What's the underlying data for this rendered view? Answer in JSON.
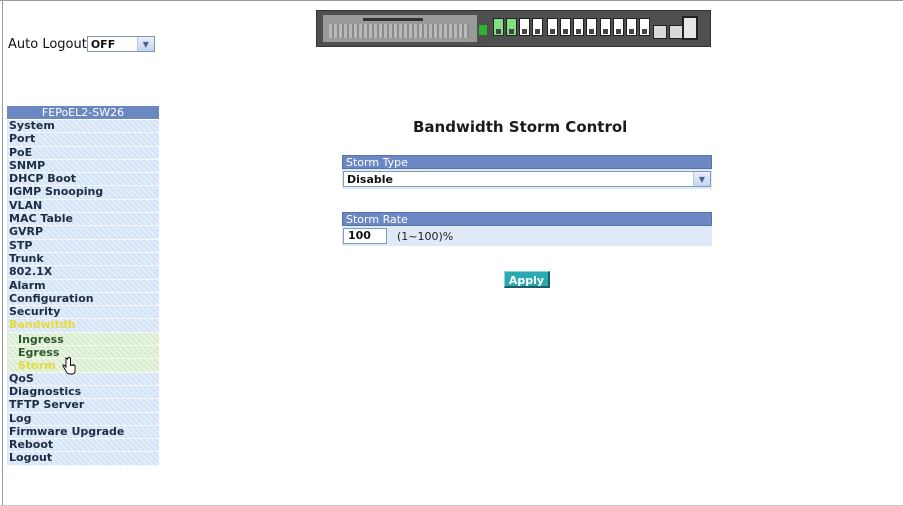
{
  "auto_logout": {
    "label": "Auto Logout",
    "value": "OFF"
  },
  "sidebar": {
    "title": "FEPoEL2-SW26",
    "items_before": [
      "System",
      "Port",
      "PoE",
      "SNMP",
      "DHCP Boot",
      "IGMP Snooping",
      "VLAN",
      "MAC Table",
      "GVRP",
      "STP",
      "Trunk",
      "802.1X",
      "Alarm",
      "Configuration",
      "Security"
    ],
    "open_item": "Bandwitdh",
    "subitems": [
      "Ingress",
      "Egress",
      "Storm"
    ],
    "active_subitem": "Storm",
    "items_after": [
      "QoS",
      "Diagnostics",
      "TFTP Server",
      "Log",
      "Firmware Upgrade",
      "Reboot",
      "Logout"
    ]
  },
  "main": {
    "title": "Bandwidth Storm Control",
    "storm_type": {
      "header": "Storm Type",
      "value": "Disable"
    },
    "storm_rate": {
      "header": "Storm Rate",
      "value": "100",
      "range": "(1~100)%"
    },
    "apply_label": "Apply"
  },
  "colors": {
    "header_blue": "#6b87c4",
    "apply_teal": "#2ba9b3",
    "active_yellow": "#e8da3a"
  }
}
